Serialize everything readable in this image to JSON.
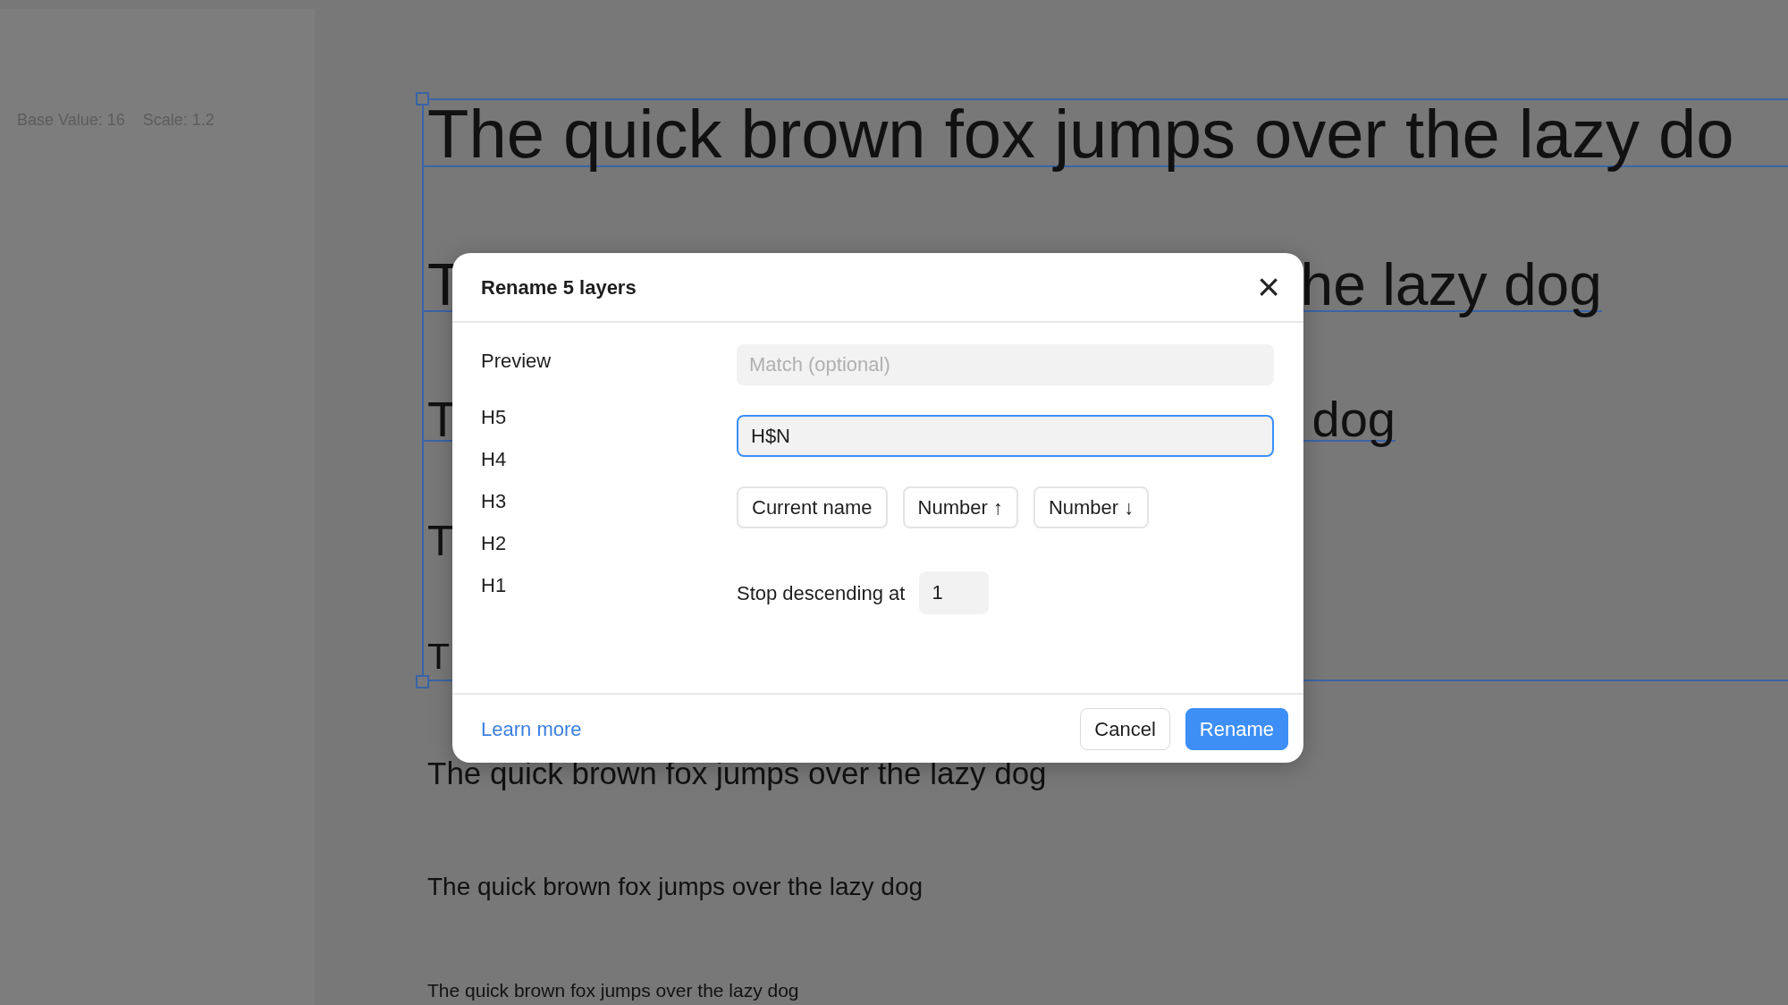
{
  "sidebar": {
    "base_value": "Base Value: 16",
    "scale": "Scale: 1.2"
  },
  "canvas": {
    "lines": [
      {
        "left": "The quick brown fox jumps over the lazy do"
      },
      {
        "left": "T",
        "right": "he lazy dog"
      },
      {
        "left": "T",
        "right": "dog"
      },
      {
        "left": "T"
      },
      {
        "left": "T"
      },
      {
        "left": "The quick brown fox jumps over the lazy dog"
      },
      {
        "left": "The quick brown fox jumps over the lazy dog"
      },
      {
        "left": "The quick brown fox jumps over the lazy dog"
      }
    ]
  },
  "dialog": {
    "title": "Rename 5 layers",
    "close": "×",
    "preview_label": "Preview",
    "preview": [
      "H5",
      "H4",
      "H3",
      "H2",
      "H1"
    ],
    "match": {
      "placeholder": "Match (optional)"
    },
    "rename_field": {
      "value": "H$N",
      "focused": true
    },
    "tokens": [
      "Current name",
      "Number ↑",
      "Number ↓"
    ],
    "stop": {
      "label": "Stop descending at",
      "value": "1"
    },
    "learn_more": "Learn more",
    "buttons": [
      {
        "label": "Cancel",
        "kind": "secondary"
      },
      {
        "label": "Rename",
        "kind": "primary"
      }
    ]
  }
}
